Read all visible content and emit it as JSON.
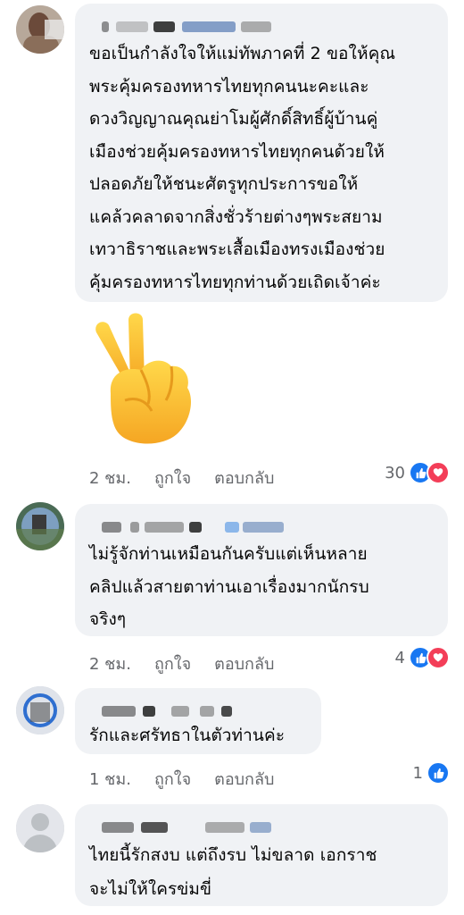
{
  "comments": [
    {
      "author": "",
      "text": "ขอเป็นกำลังใจให้แม่ทัพภาคที่ 2 ขอให้คุณ\nพระคุ้มครองทหารไทยทุกคนนะคะและ\nดวงวิญญาณคุณย่าโมผู้ศักดิ์สิทธิ์ผู้บ้านคู่\nเมืองช่วยคุ้มครองทหารไทยทุกคนด้วยให้\nปลอดภัยให้ชนะศัตรูทุกประการขอให้\nแคล้วคลาดจากสิ่งชั่วร้ายต่างๆพระสยาม\nเทวาธิราชและพระเสื้อเมืองทรงเมืองช่วย\nคุ้มครองทหารไทยทุกท่านด้วยเถิดเจ้าค่ะ",
      "sticker": "victory-hand-emoji",
      "time": "2 ชม.",
      "like_label": "ถูกใจ",
      "reply_label": "ตอบกลับ",
      "reaction_count": "30",
      "reactions": [
        "like-icon",
        "love-icon"
      ]
    },
    {
      "author": "",
      "text": "ไม่รู้จักท่านเหมือนกันครับแต่เห็นหลาย\nคลิปแล้วสายตาท่านเอาเรื่องมากนักรบ\nจริงๆ",
      "time": "2 ชม.",
      "like_label": "ถูกใจ",
      "reply_label": "ตอบกลับ",
      "reaction_count": "4",
      "reactions": [
        "like-icon",
        "love-icon"
      ]
    },
    {
      "author": "",
      "text": "รักและศรัทธาในตัวท่านค่ะ",
      "time": "1 ชม.",
      "like_label": "ถูกใจ",
      "reply_label": "ตอบกลับ",
      "reaction_count": "1",
      "reactions": [
        "like-icon"
      ]
    },
    {
      "author": "",
      "text": "ไทยนี้รักสงบ แต่ถึงรบ ไม่ขลาด เอกราช\nจะไม่ให้ใครข่มขี่"
    }
  ],
  "colors": {
    "bubble": "#f0f2f5",
    "meta_text": "#65676b",
    "like_blue": "#1877f2",
    "love_red": "#f33e58"
  }
}
